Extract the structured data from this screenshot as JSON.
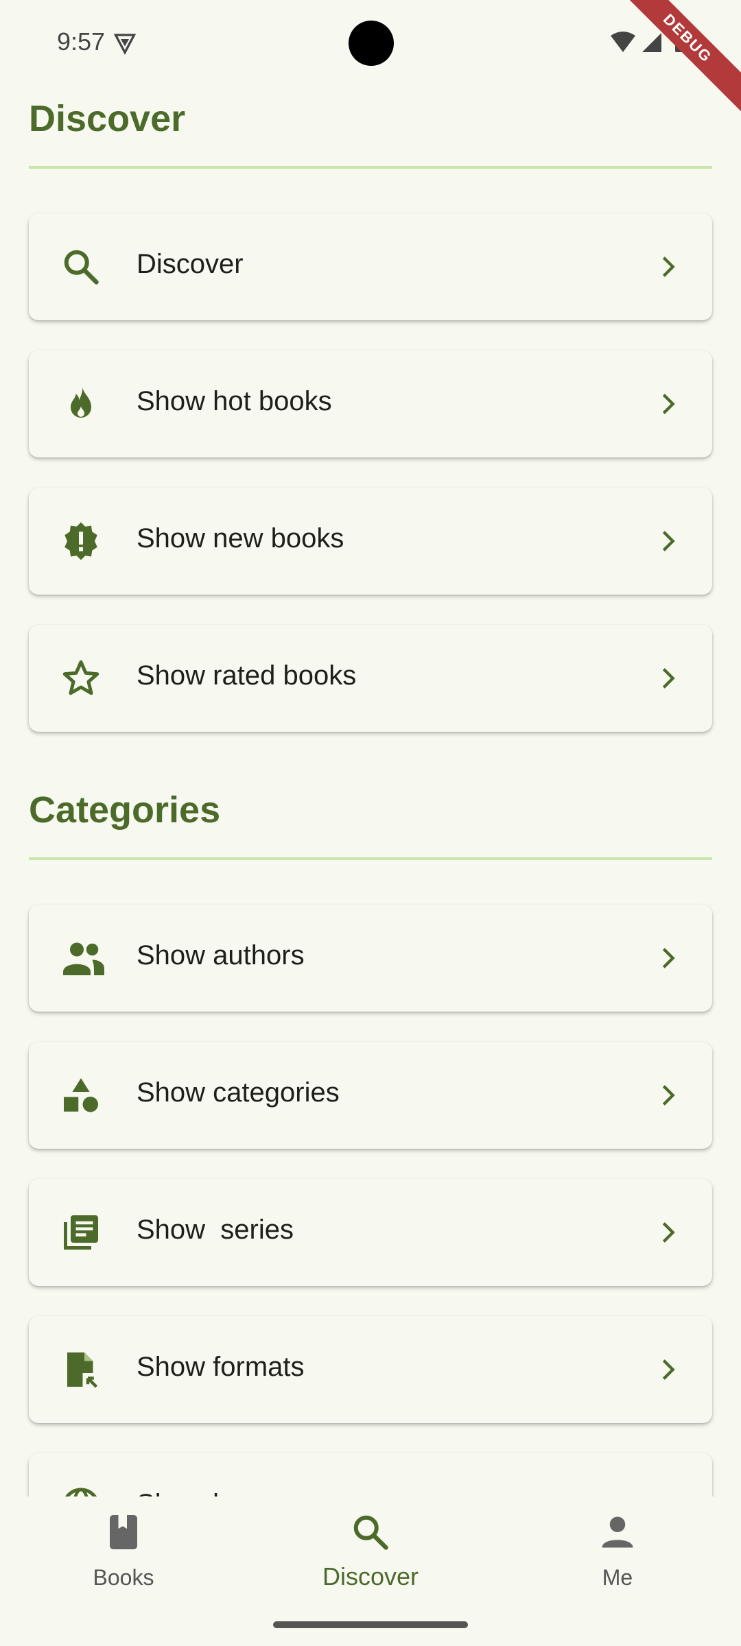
{
  "status_bar": {
    "time": "9:57"
  },
  "debug_label": "DEBUG",
  "discover_section": {
    "title": "Discover",
    "items": [
      {
        "label": "Discover",
        "icon": "search-icon"
      },
      {
        "label": "Show hot books",
        "icon": "fire-icon"
      },
      {
        "label": "Show new books",
        "icon": "new-badge-icon"
      },
      {
        "label": "Show rated books",
        "icon": "star-icon"
      }
    ]
  },
  "categories_section": {
    "title": "Categories",
    "items": [
      {
        "label": "Show authors",
        "icon": "people-icon"
      },
      {
        "label": "Show categories",
        "icon": "shapes-icon"
      },
      {
        "label": "Show  series",
        "icon": "library-books-icon"
      },
      {
        "label": "Show formats",
        "icon": "file-icon"
      },
      {
        "label": "Show languages",
        "icon": "globe-icon"
      }
    ]
  },
  "bottom_nav": {
    "items": [
      {
        "label": "Books",
        "icon": "book-icon",
        "active": false
      },
      {
        "label": "Discover",
        "icon": "search-icon",
        "active": true
      },
      {
        "label": "Me",
        "icon": "person-icon",
        "active": false
      }
    ]
  },
  "colors": {
    "accent": "#4c6b2a",
    "background": "#f7f8ef",
    "divider": "#c8e6a8",
    "debug": "#b33a3a"
  }
}
